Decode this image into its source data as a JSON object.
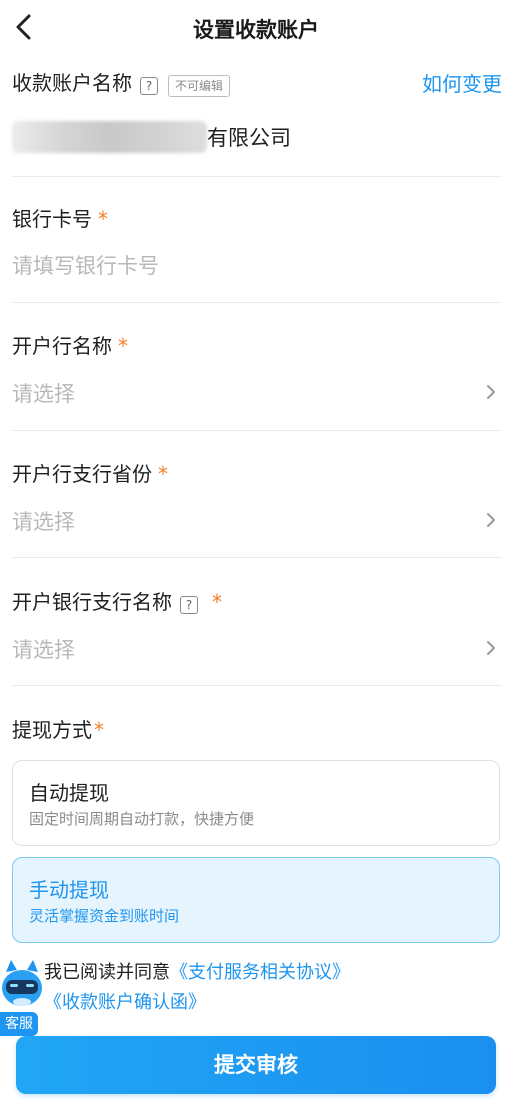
{
  "header": {
    "title": "设置收款账户",
    "back_icon": "chevron-left-icon"
  },
  "account_name": {
    "label": "收款账户名称",
    "help_icon": "?",
    "tag": "不可编辑",
    "how_link": "如何变更",
    "value_suffix": "有限公司"
  },
  "bank_card": {
    "label": "银行卡号",
    "required_mark": "*",
    "placeholder": "请填写银行卡号"
  },
  "bank_name": {
    "label": "开户行名称",
    "required_mark": "*",
    "placeholder": "请选择"
  },
  "bank_province": {
    "label": "开户行支行省份",
    "required_mark": "*",
    "placeholder": "请选择"
  },
  "branch_name": {
    "label": "开户银行支行名称",
    "help_icon": "?",
    "required_mark": "*",
    "placeholder": "请选择"
  },
  "withdraw": {
    "label": "提现方式",
    "required_mark": "*",
    "options": [
      {
        "title": "自动提现",
        "desc": "固定时间周期自动打款，快捷方便",
        "selected": false
      },
      {
        "title": "手动提现",
        "desc": "灵活掌握资金到账时间",
        "selected": true
      }
    ]
  },
  "agreement": {
    "prefix": "我已阅读并同意",
    "link1": "《支付服务相关协议》",
    "link2": "《收款账户确认函》"
  },
  "customer_service": {
    "label": "客服"
  },
  "submit": {
    "label": "提交审核"
  },
  "colors": {
    "accent": "#1e95f0",
    "required": "#f57c24",
    "placeholder": "#b8b8b8"
  }
}
